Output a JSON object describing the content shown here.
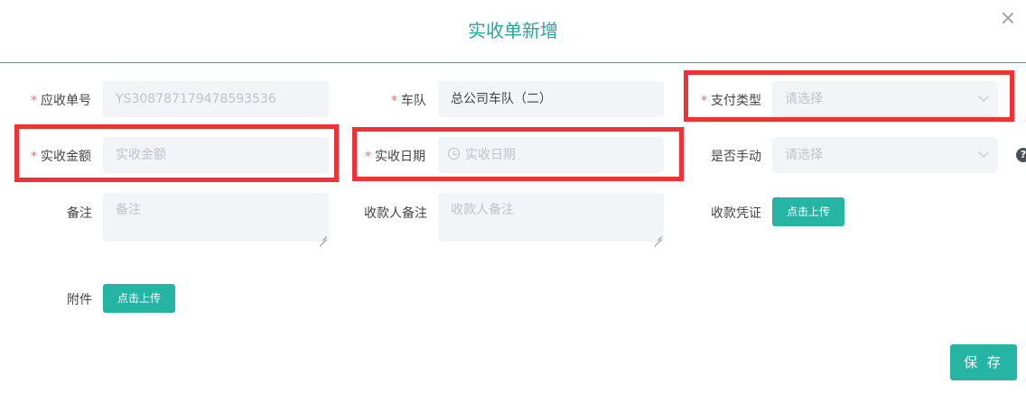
{
  "dialog": {
    "title": "实收单新增"
  },
  "fields": {
    "receivable_no": {
      "label": "应收单号",
      "value": "YS308787179478593536"
    },
    "fleet": {
      "label": "车队",
      "value": "总公司车队（二）"
    },
    "pay_type": {
      "label": "支付类型",
      "placeholder": "请选择"
    },
    "amount": {
      "label": "实收金额",
      "placeholder": "实收金额"
    },
    "date": {
      "label": "实收日期",
      "placeholder": "实收日期"
    },
    "manual": {
      "label": "是否手动",
      "placeholder": "请选择"
    },
    "remark": {
      "label": "备注",
      "placeholder": "备注"
    },
    "payee_remark": {
      "label": "收款人备注",
      "placeholder": "收款人备注"
    },
    "voucher": {
      "label": "收款凭证",
      "button": "点击上传"
    },
    "attachment": {
      "label": "附件",
      "button": "点击上传"
    }
  },
  "help": {
    "text": "?"
  },
  "actions": {
    "save": "保 存"
  },
  "colors": {
    "accent": "#26b5a4",
    "title": "#26a69a",
    "required": "#f56c6c",
    "highlight": "#ee3338"
  }
}
